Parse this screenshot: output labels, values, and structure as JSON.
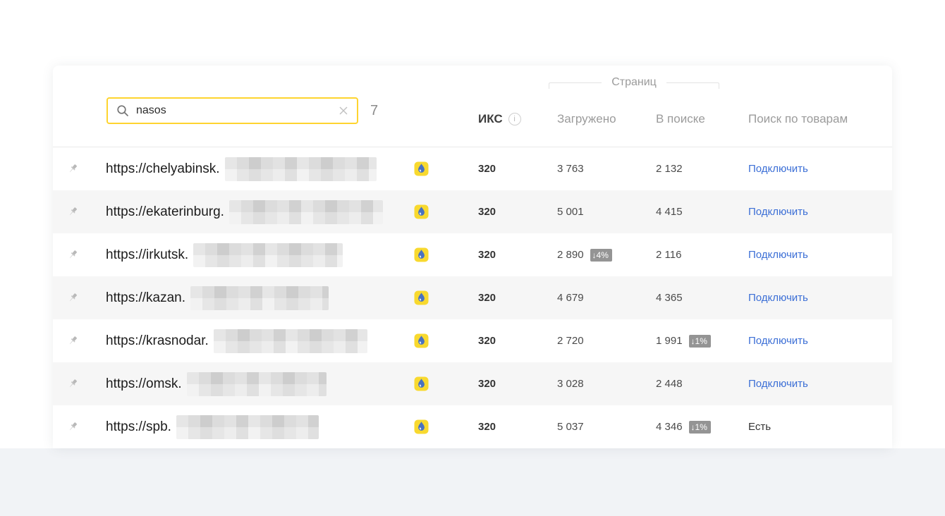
{
  "search": {
    "value": "nasos",
    "results_count": "7"
  },
  "header": {
    "iks": "ИКС",
    "info_icon_glyph": "i",
    "pages_group": "Страниц",
    "loaded": "Загружено",
    "in_search": "В поиске",
    "product_search": "Поиск по товарам"
  },
  "colors": {
    "search_border_yellow": "#fed42f",
    "favicon_yellow": "#f8d92f",
    "favicon_drop_blue": "#4a72c0",
    "link_blue": "#3c6fd6",
    "badge_gray": "#949494",
    "alt_row_gray": "#f6f6f6",
    "page_bottom_gray": "#f1f3f6"
  },
  "rows": [
    {
      "url_prefix": "https://chelyabinsk.",
      "iks": "320",
      "loaded": "3 763",
      "in_search": "2 132",
      "action_link": "Подключить"
    },
    {
      "url_prefix": "https://ekaterinburg.",
      "iks": "320",
      "loaded": "5 001",
      "in_search": "4 415",
      "action_link": "Подключить"
    },
    {
      "url_prefix": "https://irkutsk.",
      "iks": "320",
      "loaded": "2 890",
      "loaded_badge": "↓4%",
      "in_search": "2 116",
      "action_link": "Подключить"
    },
    {
      "url_prefix": "https://kazan.",
      "iks": "320",
      "loaded": "4 679",
      "in_search": "4 365",
      "action_link": "Подключить"
    },
    {
      "url_prefix": "https://krasnodar.",
      "iks": "320",
      "loaded": "2 720",
      "in_search": "1 991",
      "in_search_badge": "↓1%",
      "action_link": "Подключить"
    },
    {
      "url_prefix": "https://omsk.",
      "iks": "320",
      "loaded": "3 028",
      "in_search": "2 448",
      "action_link": "Подключить"
    },
    {
      "url_prefix": "https://spb.",
      "iks": "320",
      "loaded": "5 037",
      "in_search": "4 346",
      "in_search_badge": "↓1%",
      "action_text": "Есть"
    }
  ]
}
